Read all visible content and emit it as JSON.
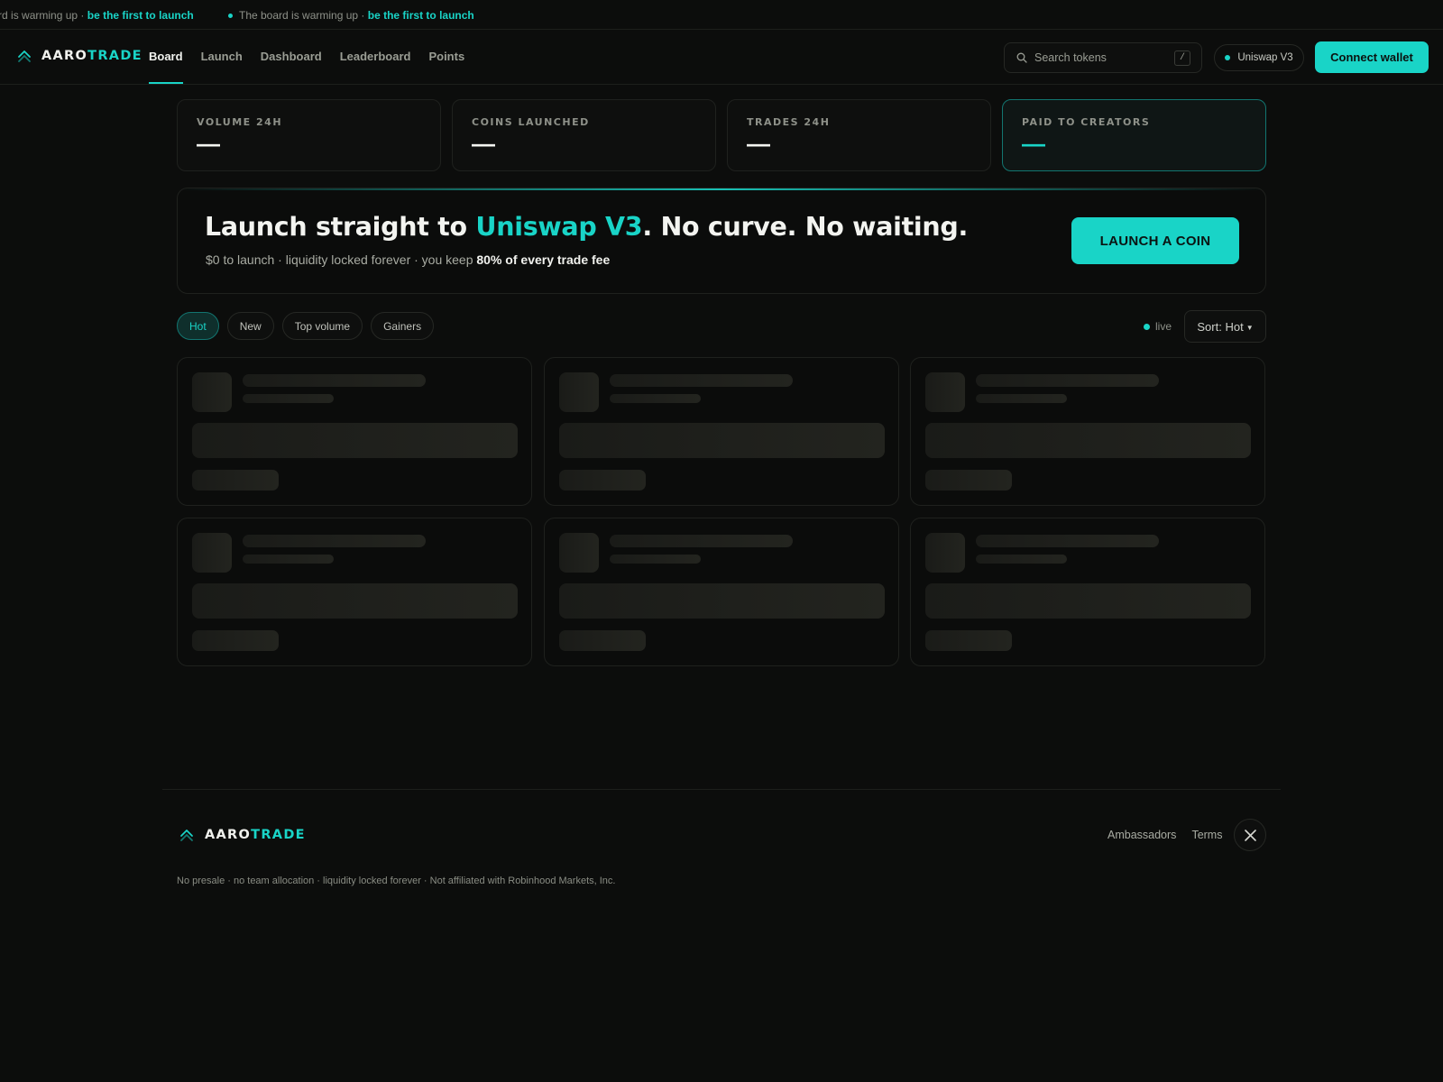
{
  "ticker": {
    "items": [
      {
        "text": "The board is warming up · ",
        "accent": "be the first to launch"
      },
      {
        "text": "The board is warming up · ",
        "accent": "be the first to launch"
      }
    ]
  },
  "header": {
    "brand": {
      "part1": "AARO",
      "part2": "TRADE"
    },
    "nav": [
      "Board",
      "Launch",
      "Dashboard",
      "Leaderboard",
      "Points"
    ],
    "active_nav": "Board",
    "search": {
      "placeholder": "Search tokens",
      "shortcut": "/"
    },
    "network": "Uniswap V3",
    "connect_label": "Connect wallet"
  },
  "stats": [
    {
      "label": "VOLUME 24H",
      "value": "—"
    },
    {
      "label": "COINS LAUNCHED",
      "value": "—"
    },
    {
      "label": "TRADES 24H",
      "value": "—"
    },
    {
      "label": "PAID TO CREATORS",
      "value": "—"
    }
  ],
  "hero": {
    "title_pre": "Launch straight to ",
    "title_accent": "Uniswap V3",
    "title_post": ". No curve. No waiting.",
    "subtitle_pre": "$0 to launch · liquidity locked forever · you keep ",
    "subtitle_bold": "80% of every trade fee",
    "cta": "LAUNCH A COIN"
  },
  "filters": {
    "tabs": [
      "Hot",
      "New",
      "Top volume",
      "Gainers"
    ],
    "active": "Hot",
    "live_label": "live",
    "sort_label": "Sort: Hot"
  },
  "footer": {
    "brand": {
      "part1": "AARO",
      "part2": "TRADE"
    },
    "links": [
      "Ambassadors",
      "Terms"
    ],
    "disclaimer": "No presale · no team allocation · liquidity locked forever · Not affiliated with Robinhood Markets, Inc."
  },
  "colors": {
    "accent": "#19d4c7",
    "background": "#0c0d0c",
    "surface": "#0e0f0e",
    "border": "#1f211e"
  },
  "icons": {
    "brand": "double-chevron-up-icon",
    "search": "search-icon",
    "social": "x-icon"
  }
}
